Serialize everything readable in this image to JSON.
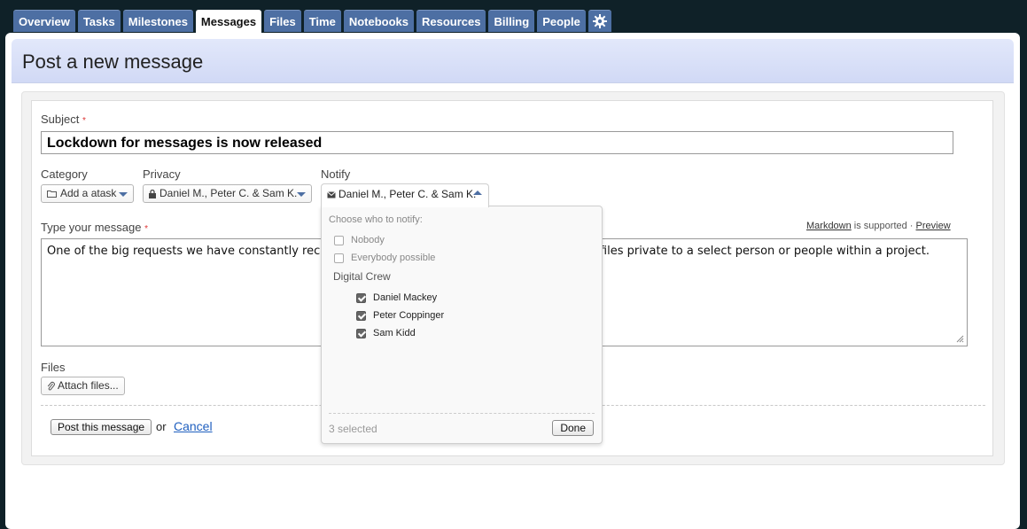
{
  "tabs": {
    "overview": "Overview",
    "tasks": "Tasks",
    "milestones": "Milestones",
    "messages": "Messages",
    "files": "Files",
    "time": "Time",
    "notebooks": "Notebooks",
    "resources": "Resources",
    "billing": "Billing",
    "people": "People",
    "settings_icon": "gear-icon"
  },
  "page_title": "Post a new message",
  "form": {
    "subject_label": "Subject",
    "required_mark": "*",
    "subject_value": "Lockdown for messages is now released",
    "category_label": "Category",
    "category_value": "Add a atask",
    "privacy_label": "Privacy",
    "privacy_value": "Daniel M., Peter C. & Sam K.",
    "notify_label": "Notify",
    "notify_value": "Daniel M., Peter C. & Sam K.",
    "message_label": "Type your message",
    "message_value": "One of the big requests we have constantly received                                                            to make both messages and the attached files private to a select person or people within a project.",
    "markdown_link": "Markdown",
    "markdown_text": " is supported · ",
    "preview_link": "Preview",
    "files_label": "Files",
    "attach_button": "Attach files...",
    "post_button": "Post this message",
    "or_text": "or",
    "cancel_link": "Cancel"
  },
  "notify_popup": {
    "heading": "Choose who to notify:",
    "general_options": [
      {
        "label": "Nobody",
        "checked": false
      },
      {
        "label": "Everybody possible",
        "checked": false
      }
    ],
    "group_name": "Digital Crew",
    "members": [
      {
        "label": "Daniel Mackey",
        "checked": true
      },
      {
        "label": "Peter Coppinger",
        "checked": true
      },
      {
        "label": "Sam Kidd",
        "checked": true
      }
    ],
    "selected_count": "3 selected",
    "done_button": "Done"
  },
  "colors": {
    "tab_bg": "#4d6fa3",
    "background": "#0f2128",
    "title_bar": "#d8dff7",
    "link": "#1f5fbf"
  }
}
